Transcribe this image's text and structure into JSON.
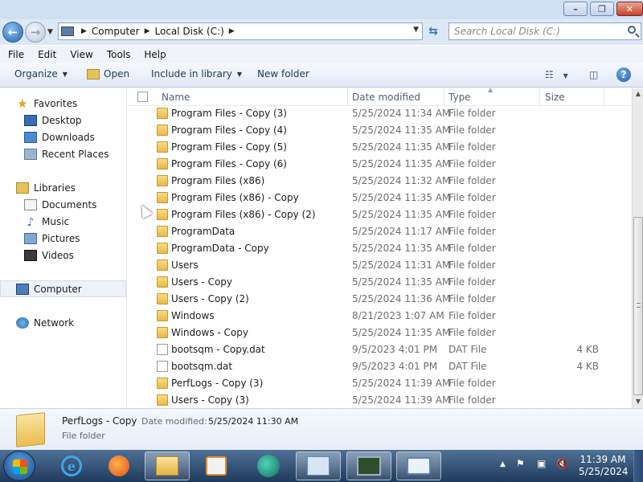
{
  "address": {
    "crumbs": [
      "Computer",
      "Local Disk (C:)"
    ],
    "search_placeholder": "Search Local Disk (C:)"
  },
  "menu": [
    "File",
    "Edit",
    "View",
    "Tools",
    "Help"
  ],
  "commands": {
    "organize": "Organize",
    "open": "Open",
    "include": "Include in library",
    "new_folder": "New folder"
  },
  "nav": {
    "favorites": "Favorites",
    "desktop": "Desktop",
    "downloads": "Downloads",
    "recent": "Recent Places",
    "libraries": "Libraries",
    "documents": "Documents",
    "music": "Music",
    "pictures": "Pictures",
    "videos": "Videos",
    "computer": "Computer",
    "network": "Network"
  },
  "columns": {
    "name": "Name",
    "date": "Date modified",
    "type": "Type",
    "size": "Size"
  },
  "files": [
    {
      "name": "Program Files - Copy (3)",
      "date": "5/25/2024 11:34 AM",
      "type": "File folder",
      "size": "",
      "kind": "folder"
    },
    {
      "name": "Program Files - Copy (4)",
      "date": "5/25/2024 11:35 AM",
      "type": "File folder",
      "size": "",
      "kind": "folder"
    },
    {
      "name": "Program Files - Copy (5)",
      "date": "5/25/2024 11:35 AM",
      "type": "File folder",
      "size": "",
      "kind": "folder"
    },
    {
      "name": "Program Files - Copy (6)",
      "date": "5/25/2024 11:35 AM",
      "type": "File folder",
      "size": "",
      "kind": "folder"
    },
    {
      "name": "Program Files (x86)",
      "date": "5/25/2024 11:32 AM",
      "type": "File folder",
      "size": "",
      "kind": "folder"
    },
    {
      "name": "Program Files (x86) - Copy",
      "date": "5/25/2024 11:35 AM",
      "type": "File folder",
      "size": "",
      "kind": "folder"
    },
    {
      "name": "Program Files (x86) - Copy (2)",
      "date": "5/25/2024 11:35 AM",
      "type": "File folder",
      "size": "",
      "kind": "folder"
    },
    {
      "name": "ProgramData",
      "date": "5/25/2024 11:17 AM",
      "type": "File folder",
      "size": "",
      "kind": "folder"
    },
    {
      "name": "ProgramData - Copy",
      "date": "5/25/2024 11:35 AM",
      "type": "File folder",
      "size": "",
      "kind": "folder"
    },
    {
      "name": "Users",
      "date": "5/25/2024 11:31 AM",
      "type": "File folder",
      "size": "",
      "kind": "folder"
    },
    {
      "name": "Users - Copy",
      "date": "5/25/2024 11:35 AM",
      "type": "File folder",
      "size": "",
      "kind": "folder"
    },
    {
      "name": "Users - Copy (2)",
      "date": "5/25/2024 11:36 AM",
      "type": "File folder",
      "size": "",
      "kind": "folder"
    },
    {
      "name": "Windows",
      "date": "8/21/2023 1:07 AM",
      "type": "File folder",
      "size": "",
      "kind": "folder"
    },
    {
      "name": "Windows - Copy",
      "date": "5/25/2024 11:35 AM",
      "type": "File folder",
      "size": "",
      "kind": "folder"
    },
    {
      "name": "bootsqm - Copy.dat",
      "date": "9/5/2023 4:01 PM",
      "type": "DAT File",
      "size": "4 KB",
      "kind": "file"
    },
    {
      "name": "bootsqm.dat",
      "date": "9/5/2023 4:01 PM",
      "type": "DAT File",
      "size": "4 KB",
      "kind": "file"
    },
    {
      "name": "PerfLogs - Copy (3)",
      "date": "5/25/2024 11:39 AM",
      "type": "File folder",
      "size": "",
      "kind": "folder"
    },
    {
      "name": "Users - Copy (3)",
      "date": "5/25/2024 11:39 AM",
      "type": "File folder",
      "size": "",
      "kind": "folder"
    }
  ],
  "details": {
    "name": "PerfLogs - Copy",
    "modified_label": "Date modified:",
    "modified_value": "5/25/2024 11:30 AM",
    "type": "File folder"
  },
  "taskbar": {
    "time": "11:39 AM",
    "date": "5/25/2024"
  },
  "colors": {
    "titlebar": "#cfe0f3",
    "accent": "#1e395b",
    "taskbar": "#2b4a70",
    "folder": "#e7b94a"
  }
}
